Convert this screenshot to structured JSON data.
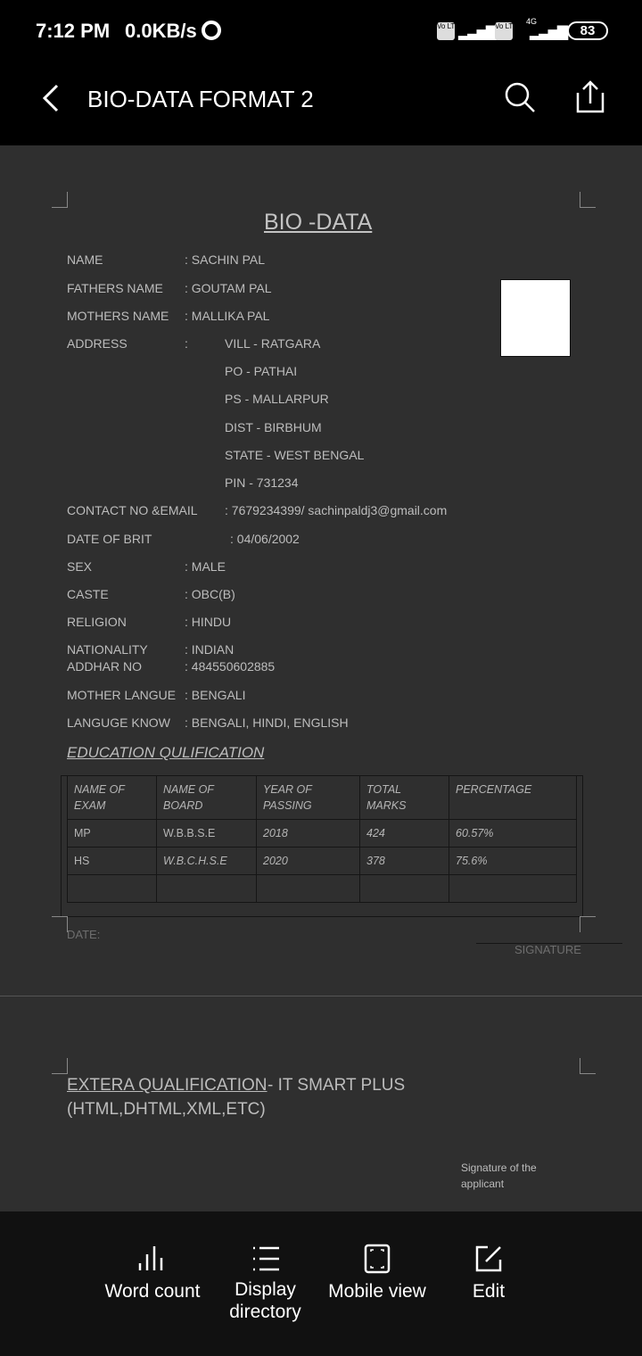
{
  "status_bar": {
    "time": "7:12 PM",
    "net_speed": "0.0KB/s",
    "battery": "83",
    "sim1": "Vo LTE",
    "sim2": "Vo LTE",
    "network": "4G"
  },
  "app_bar": {
    "title": "BIO-DATA FORMAT 2"
  },
  "document": {
    "title": "BIO -DATA",
    "fields": [
      {
        "label": "NAME",
        "value": ":  SACHIN   PAL"
      },
      {
        "label": "FATHERS NAME",
        "value": ": GOUTAM  PAL"
      },
      {
        "label": "MOTHERS NAME",
        "value": ": MALLIKA PAL"
      },
      {
        "label": "ADDRESS",
        "value": ":"
      },
      {
        "label": "CONTACT NO &EMAIL",
        "value": ":  7679234399/ sachinpaldj3@gmail.com"
      },
      {
        "label": "DATE  OF BRIT",
        "value": ": 04/06/2002"
      },
      {
        "label": "SEX",
        "value": ": MALE"
      },
      {
        "label": "CASTE",
        "value": ": OBC(B)"
      },
      {
        "label": "RELIGION",
        "value": ":  HINDU"
      },
      {
        "label": "NATIONALITY",
        "value": ": INDIAN"
      },
      {
        "label": "ADDHAR  NO",
        "value": ": 484550602885"
      },
      {
        "label": "MOTHER  LANGUE",
        "value": ": BENGALI"
      },
      {
        "label": "LANGUGE  KNOW",
        "value": ": BENGALI, HINDI, ENGLISH"
      }
    ],
    "address_lines": [
      "VILL - RATGARA",
      "PO  - PATHAI",
      "PS - MALLARPUR",
      "DIST - BIRBHUM",
      "STATE -  WEST  BENGAL",
      "PIN  -  731234"
    ],
    "education_heading": "EDUCATION QULIFICATION",
    "table": {
      "headers": [
        "NAME  OF EXAM",
        "NAME  OF BOARD",
        "YEAR  OF PASSING",
        "TOTAL  MARKS",
        "PERCENTAGE"
      ],
      "rows": [
        [
          "MP",
          "W.B.B.S.E",
          "2018",
          "424",
          "60.57%"
        ],
        [
          "HS",
          "W.B.C.H.S.E",
          "2020",
          "378",
          "75.6%"
        ],
        [
          "",
          "",
          "",
          "",
          ""
        ]
      ]
    },
    "date_label": "DATE:",
    "signature_label": "SIGNATURE",
    "extra_label": "EXTERA QUALIFICATION ",
    "extra_value": "-  IT SMART PLUS",
    "extra_value2": "(HTML,DHTML,XML,ETC)",
    "applicant_signature": "Signature of the applicant"
  },
  "bottom_bar": {
    "items": [
      {
        "label": "Word count",
        "icon": "bar-chart-icon"
      },
      {
        "label": "Display directory",
        "icon": "list-icon"
      },
      {
        "label": "Mobile view",
        "icon": "mobile-view-icon"
      },
      {
        "label": "Edit",
        "icon": "edit-icon"
      }
    ]
  }
}
